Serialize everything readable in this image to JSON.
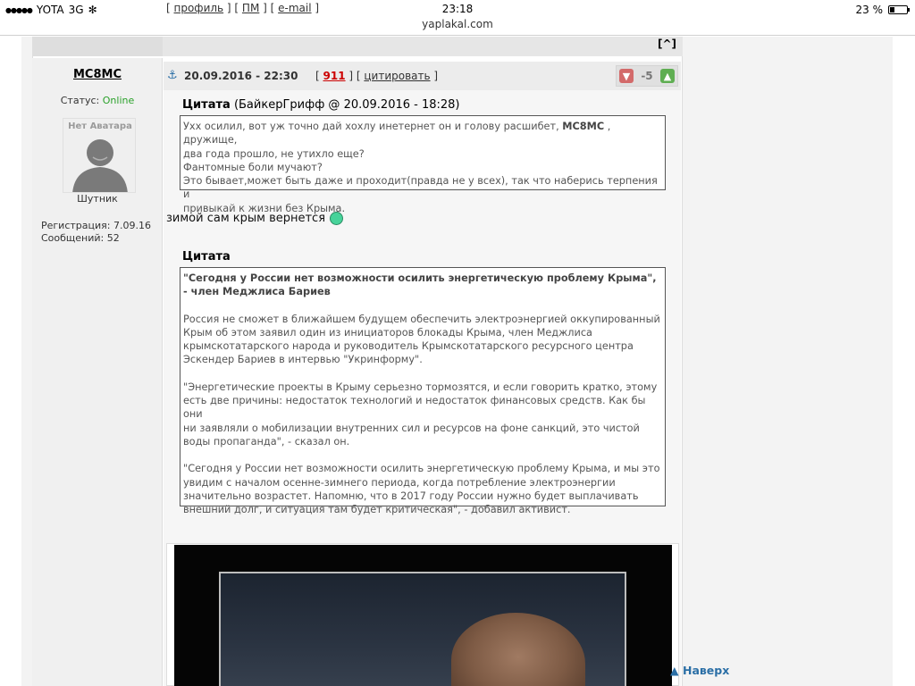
{
  "status_bar": {
    "carrier": "YOTA",
    "network": "3G",
    "time": "23:18",
    "url": "yaplakal.com",
    "battery": "23 %",
    "battery_level_percent": 23
  },
  "prev_post": {
    "links": [
      "профиль",
      "ПМ",
      "e-mail"
    ],
    "top_label": "[^]"
  },
  "author": {
    "name": "MC8MC",
    "status_label": "Статус:",
    "status_value": "Online",
    "avatar_text": "Нет Аватара",
    "rank": "Шутник",
    "reg_label": "Регистрация:",
    "reg_value": "7.09.16",
    "posts_label": "Сообщений:",
    "posts_value": "52"
  },
  "post": {
    "anchor_icon": "anchor-icon",
    "date": "20.09.2016 - 22:30",
    "post_number": "911",
    "quote_link": "цитировать",
    "rating": "-5",
    "quote1": {
      "title": "Цитата",
      "source": "(БайкерГрифф @ 20.09.2016 - 18:28)",
      "line1_start": "Ухх осилил, вот уж точно дай хохлу инетернет он и голову расшибет,",
      "line1_name": "MC8MC",
      "line1_end": ", дружище,",
      "line2": "два года прошло, не утихло еще?",
      "line3": "Фантомные боли мучают?",
      "line4": "Это бывает,может быть даже и проходит(правда не у всех), так что наберись терпения и",
      "line5": "привыкай к жизни без Крыма."
    },
    "comment": "зимой сам крым вернется",
    "quote2": {
      "title": "Цитата",
      "headline1": "\"Сегодня у России нет возможности осилить энергетическую проблему Крыма\",",
      "headline2": "- член Меджлиса Бариев",
      "p1": [
        "Россия не сможет в ближайшем будущем обеспечить электроэнергией оккупированный",
        "Крым об этом заявил один из инициаторов блокады Крыма, член Меджлиса",
        "крымскотатарского народа и руководитель Крымскотатарского ресурсного центра",
        "Эскендер Бариев в интервью \"Укринформу\"."
      ],
      "p2": [
        "\"Энергетические проекты в Крыму серьезно тормозятся, и если говорить кратко, этому",
        "есть две причины: недостаток технологий и недостаток финансовых средств. Как бы они",
        "ни заявляли о мобилизации внутренних сил и ресурсов на фоне санкций, это чистой",
        "воды пропаганда\", - сказал он."
      ],
      "p3": [
        "\"Сегодня у России нет возможности осилить энергетическую проблему Крыма, и мы это",
        "увидим с началом осенне-зимнего периода, когда потребление электроэнергии",
        "значительно возрастет. Напомню, что в 2017 году России нужно будет выплачивать",
        "внешний долг, и ситуация там будет критическая\", - добавил активист."
      ]
    }
  },
  "naverh": "Наверх"
}
